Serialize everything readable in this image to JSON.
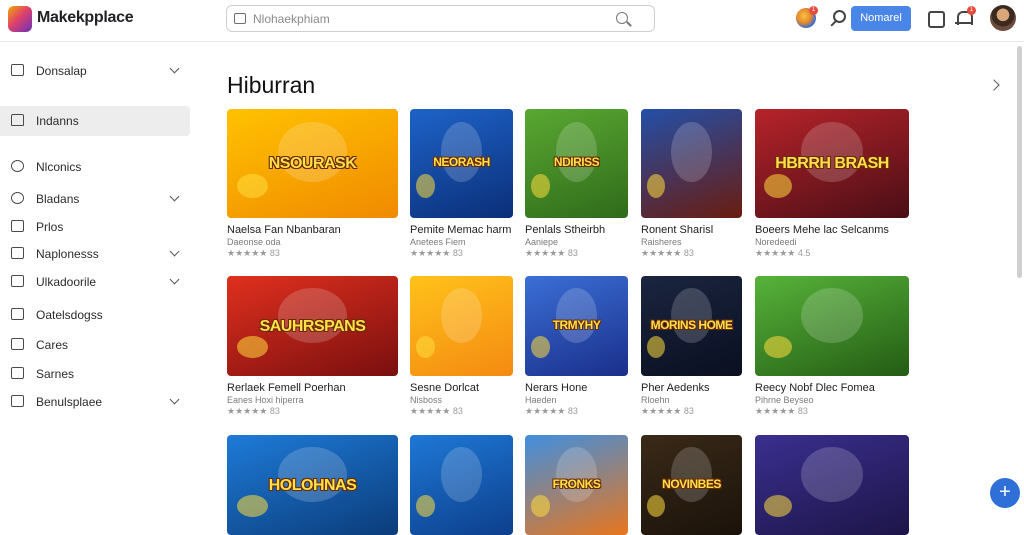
{
  "header": {
    "brand": "Makekpplace",
    "search_placeholder": "Nlohaekphiam",
    "cta_label": "Nomarel",
    "globe_badge": "1",
    "bell_badge": "1"
  },
  "sidebar": {
    "items": [
      {
        "label": "Donsalap",
        "icon": "device-icon",
        "chevron": true
      },
      {
        "label": "Indanns",
        "icon": "home-icon",
        "chevron": false
      },
      {
        "label": "Nlconics",
        "icon": "circle-icon",
        "chevron": false
      },
      {
        "label": "Bladans",
        "icon": "circle-icon",
        "chevron": true
      },
      {
        "label": "Prlos",
        "icon": "box-icon",
        "chevron": false
      },
      {
        "label": "Naplonesss",
        "icon": "grid-icon",
        "chevron": true
      },
      {
        "label": "Ulkadoorile",
        "icon": "grid-icon",
        "chevron": true
      },
      {
        "label": "Oatelsdogss",
        "icon": "list-icon",
        "chevron": false
      },
      {
        "label": "Cares",
        "icon": "box-icon",
        "chevron": false
      },
      {
        "label": "Sarnes",
        "icon": "box-icon",
        "chevron": false
      },
      {
        "label": "Benulsplaee",
        "icon": "list-icon",
        "chevron": true
      }
    ]
  },
  "main": {
    "title": "Hiburran"
  },
  "cards": [
    {
      "art": "NSOURASK",
      "title": "Naelsa Fan Nbanbaran",
      "sub": "Daeonse oda",
      "stars": "★★★★★ 83",
      "colors": [
        "#ffc200",
        "#f08a00"
      ]
    },
    {
      "art": "NEORASH",
      "title": "Pemite Memac harm",
      "sub": "Anetees Fiem",
      "stars": "★★★★★ 83",
      "colors": [
        "#1e63c9",
        "#0b2f78"
      ]
    },
    {
      "art": "NDIRISS",
      "title": "Penlals Stheirbh",
      "sub": "Aaniepe",
      "stars": "★★★★★ 83",
      "colors": [
        "#5aa832",
        "#2f6b1a"
      ]
    },
    {
      "art": "",
      "title": "Ronent Sharisl",
      "sub": "Raisheres",
      "stars": "★★★★★ 83",
      "colors": [
        "#234fa8",
        "#6a1c0f"
      ]
    },
    {
      "art": "HBRRH BRASH",
      "title": "Boeers Mehe lac Selcanms",
      "sub": "Noredeedi",
      "stars": "★★★★★ 4.5",
      "colors": [
        "#b7232a",
        "#4a0e16"
      ]
    },
    {
      "art": "SAUHRSPANS",
      "title": "Rerlaek Femell Poerhan",
      "sub": "Eanes Hoxi hiperra",
      "stars": "★★★★★ 83",
      "colors": [
        "#e0301e",
        "#7a0f0f"
      ]
    },
    {
      "art": "",
      "title": "Sesne Dorlcat",
      "sub": "Nisboss",
      "stars": "★★★★★ 83",
      "colors": [
        "#ffc21a",
        "#f48a12"
      ]
    },
    {
      "art": "TRMYHY",
      "title": "Nerars Hone",
      "sub": "Haeden",
      "stars": "★★★★★ 83",
      "colors": [
        "#3b6fd6",
        "#1a2f8a"
      ]
    },
    {
      "art": "MORINS HOME",
      "title": "Pher Aedenks",
      "sub": "Rloehn",
      "stars": "★★★★★ 83",
      "colors": [
        "#1b2540",
        "#0a0f20"
      ]
    },
    {
      "art": "",
      "title": "Reecy Nobf Dlec Fomea",
      "sub": "Pihrne Beyseo",
      "stars": "★★★★★ 83",
      "colors": [
        "#57b33a",
        "#245c14"
      ]
    },
    {
      "art": "HOLOHNAS",
      "title": "",
      "sub": "",
      "stars": "",
      "colors": [
        "#1e7bd8",
        "#0b3c7a"
      ]
    },
    {
      "art": "",
      "title": "",
      "sub": "",
      "stars": "",
      "colors": [
        "#1e78d6",
        "#0d3f8c"
      ]
    },
    {
      "art": "FRONKS",
      "title": "",
      "sub": "",
      "stars": "",
      "colors": [
        "#3f8fe0",
        "#e8761c"
      ]
    },
    {
      "art": "NOVINBES",
      "title": "",
      "sub": "",
      "stars": "",
      "colors": [
        "#3a2a18",
        "#1a120a"
      ]
    },
    {
      "art": "",
      "title": "",
      "sub": "",
      "stars": "",
      "colors": [
        "#3a2f8f",
        "#1d1548"
      ]
    }
  ],
  "fab_label": "+"
}
